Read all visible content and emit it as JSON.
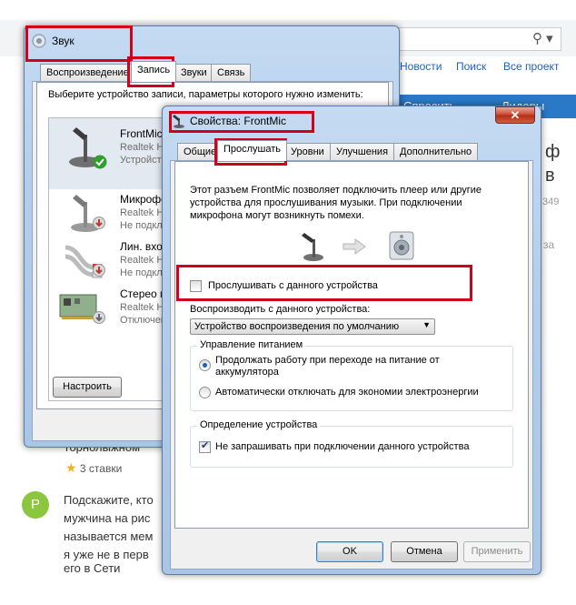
{
  "background_page": {
    "nav_links": [
      "Новости",
      "Поиск",
      "Все проект"
    ],
    "bluebar": {
      "ask": "Спросить",
      "leaders": "Лидеры"
    },
    "right_fragments": [
      "ф",
      "в",
      "349",
      "за"
    ],
    "stars": {
      "count": "3 ставки"
    },
    "avatar_letter": "P",
    "cut_text": "горнолыжном",
    "comment_lines": [
      "Подскажите, кто",
      "мужчина на рис",
      "называется мем",
      "я уже не в перв",
      "его в Сети"
    ]
  },
  "sound_window": {
    "title": "Звук",
    "tabs": [
      "Воспроизведение",
      "Запись",
      "Звуки",
      "Связь"
    ],
    "selected_tab": "Запись",
    "instructions": "Выберите устройство записи, параметры которого нужно изменить:",
    "devices": [
      {
        "name": "FrontMic",
        "sub1": "Realtek Hi",
        "sub2": "Устройство",
        "icon": "microphone-icon",
        "status": "default-check-icon"
      },
      {
        "name": "Микрофо",
        "sub1": "Realtek Hi",
        "sub2": "Не подклю",
        "icon": "microphone-icon",
        "status": "disconnected-arrow-icon"
      },
      {
        "name": "Лин. вход",
        "sub1": "Realtek Hi",
        "sub2": "Не подклю",
        "icon": "line-in-cable-icon",
        "status": "disconnected-arrow-icon"
      },
      {
        "name": "Стерео ми",
        "sub1": "Realtek Hi",
        "sub2": "Отключен",
        "icon": "sound-card-icon",
        "status": "disabled-arrow-icon"
      }
    ],
    "configure_button": "Настроить"
  },
  "props_window": {
    "title": "Свойства: FrontMic",
    "tabs": [
      "Общие",
      "Прослушать",
      "Уровни",
      "Улучшения",
      "Дополнительно"
    ],
    "selected_tab": "Прослушать",
    "description": "Этот разъем FrontMic позволяет подключить плеер или другие устройства для прослушивания музыки. При подключении микрофона могут возникнуть помехи.",
    "listen_checkbox": {
      "label": "Прослушивать с данного устройства",
      "checked": false
    },
    "playback_label": "Воспроизводить с данного устройства:",
    "playback_select": "Устройство воспроизведения по умолчанию",
    "power_group": {
      "title": "Управление питанием",
      "options": [
        {
          "label": "Продолжать работу при переходе на питание от аккумулятора",
          "selected": true
        },
        {
          "label": "Автоматически отключать для экономии электроэнергии",
          "selected": false
        }
      ]
    },
    "detect_group": {
      "title": "Определение устройства",
      "checkbox": {
        "label": "Не запрашивать при подключении данного устройства",
        "checked": true
      }
    },
    "buttons": {
      "ok": "OK",
      "cancel": "Отмена",
      "apply": "Применить"
    }
  }
}
